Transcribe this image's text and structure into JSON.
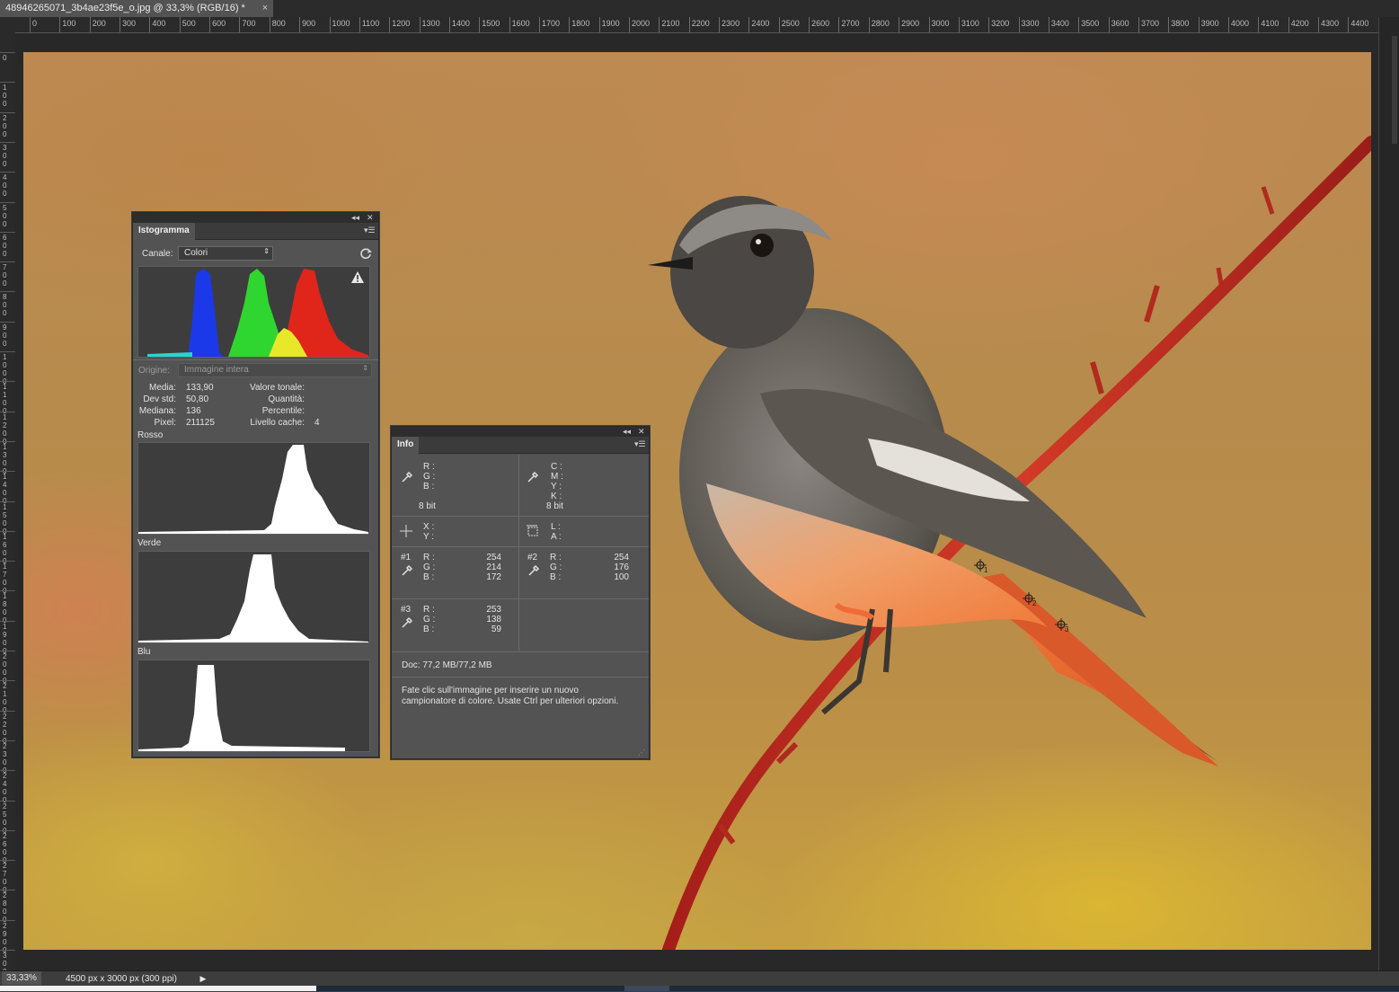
{
  "document": {
    "tab_title": "48946265071_3b4ae23f5e_o.jpg @ 33,3% (RGB/16) *",
    "tab_close": "×"
  },
  "ruler_top_labels": [
    "0",
    "100",
    "200",
    "300",
    "400",
    "500",
    "600",
    "700",
    "800",
    "900",
    "1000",
    "1100",
    "1200",
    "1300",
    "1400",
    "1500",
    "1600",
    "1700",
    "1800",
    "1900",
    "2000",
    "2100",
    "2200",
    "2300",
    "2400",
    "2500",
    "2600",
    "2700",
    "2800",
    "2900",
    "3000",
    "3100",
    "3200",
    "3300",
    "3400",
    "3500",
    "3600",
    "3700",
    "3800",
    "3900",
    "4000",
    "4100",
    "4200",
    "4300",
    "4400"
  ],
  "ruler_left_labels": [
    "0",
    "100",
    "200",
    "300",
    "400",
    "500",
    "600",
    "700",
    "800",
    "900",
    "1000",
    "1100",
    "1200",
    "1300",
    "1400",
    "1500",
    "1600",
    "1700",
    "1800",
    "1900",
    "2000",
    "2100",
    "2200",
    "2300",
    "2400",
    "2500",
    "2600",
    "2700",
    "2800",
    "2900",
    "3000"
  ],
  "histogram_panel": {
    "tab": "Istogramma",
    "channel_label": "Canale:",
    "channel_value": "Colori",
    "source_label": "Origine:",
    "source_value": "Immagine intera",
    "stats_left": [
      {
        "label": "Media:",
        "value": "133,90"
      },
      {
        "label": "Dev std:",
        "value": "50,80"
      },
      {
        "label": "Mediana:",
        "value": "136"
      },
      {
        "label": "Pixel:",
        "value": "211125"
      }
    ],
    "stats_right": [
      {
        "label": "Valore tonale:",
        "value": ""
      },
      {
        "label": "Quantità:",
        "value": ""
      },
      {
        "label": "Percentile:",
        "value": ""
      },
      {
        "label": "Livello cache:",
        "value": "4"
      }
    ],
    "channels": [
      "Rosso",
      "Verde",
      "Blu"
    ],
    "colors": {
      "red": "#e0251b",
      "green": "#2fd62f",
      "blue": "#1b39e8",
      "yellow": "#e8e82a",
      "cyan": "#30d0d0"
    }
  },
  "info_panel": {
    "tab": "Info",
    "rgb_labels": [
      "R :",
      "G :",
      "B :"
    ],
    "cmyk_labels": [
      "C :",
      "M :",
      "Y :",
      "K :"
    ],
    "bit_left": "8 bit",
    "bit_right": "8 bit",
    "xy_labels": [
      "X :",
      "Y :"
    ],
    "la_labels": [
      "L :",
      "A :"
    ],
    "samplers": [
      {
        "id": "#1",
        "labels": [
          "R :",
          "G :",
          "B :"
        ],
        "values": [
          "254",
          "214",
          "172"
        ]
      },
      {
        "id": "#2",
        "labels": [
          "R :",
          "G :",
          "B :"
        ],
        "values": [
          "254",
          "176",
          "100"
        ]
      },
      {
        "id": "#3",
        "labels": [
          "R :",
          "G :",
          "B :"
        ],
        "values": [
          "253",
          "138",
          "59"
        ]
      }
    ],
    "doc": "Doc: 77,2 MB/77,2 MB",
    "hint": "Fate clic sull'immagine per inserire un nuovo campionatore di colore. Usate Ctrl per ulteriori opzioni."
  },
  "canvas_markers": [
    "1",
    "2",
    "3"
  ],
  "status": {
    "zoom": "33,33%",
    "doc_size": "4500 px x 3000 px (300 ppi)"
  }
}
